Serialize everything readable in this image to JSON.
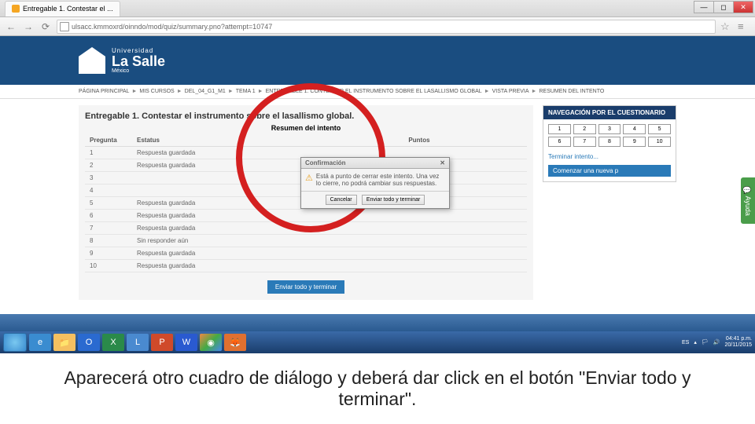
{
  "browser": {
    "tab_title": "Entregable 1. Contestar el ...",
    "url": "ulsacc.kmmoxrd/oinndo/mod/quiz/summary.pno?attempt=10747"
  },
  "logo": {
    "uni": "Universidad",
    "main": "La Salle",
    "sub": "México"
  },
  "breadcrumb": [
    "PÁGINA PRINCIPAL",
    "MIS CURSOS",
    "DEL_04_G1_M1",
    "TEMA 1",
    "ENTREGABLE 1. CONTESTAR EL INSTRUMENTO SOBRE EL LASALLISMO GLOBAL",
    "VISTA PREVIA",
    "RESUMEN DEL INTENTO"
  ],
  "page": {
    "title": "Entregable 1. Contestar el instrumento sobre el lasallismo global.",
    "table_title": "Resumen del intento",
    "headers": {
      "q": "Pregunta",
      "s": "Estatus",
      "p": "Puntos"
    },
    "rows": [
      {
        "n": "1",
        "s": "Respuesta guardada"
      },
      {
        "n": "2",
        "s": "Respuesta guardada"
      },
      {
        "n": "3",
        "s": ""
      },
      {
        "n": "4",
        "s": ""
      },
      {
        "n": "5",
        "s": "Respuesta guardada"
      },
      {
        "n": "6",
        "s": "Respuesta guardada"
      },
      {
        "n": "7",
        "s": "Respuesta guardada"
      },
      {
        "n": "8",
        "s": "Sin responder aún"
      },
      {
        "n": "9",
        "s": "Respuesta guardada"
      },
      {
        "n": "10",
        "s": "Respuesta guardada"
      }
    ],
    "submit": "Enviar todo y terminar"
  },
  "sidebar": {
    "title": "NAVEGACIÓN POR EL CUESTIONARIO",
    "nums": [
      "1",
      "2",
      "3",
      "4",
      "5",
      "6",
      "7",
      "8",
      "9",
      "10"
    ],
    "finish": "Terminar intento...",
    "new": "Comenzar una nueva p"
  },
  "dialog": {
    "title": "Confirmación",
    "body": "Está a punto de cerrar este intento. Una vez lo cierre, no podrá cambiar sus respuestas.",
    "cancel": "Cancelar",
    "confirm": "Enviar todo y terminar"
  },
  "ayuda": "Ayuda",
  "clock": {
    "time": "04:41 p.m.",
    "date": "20/11/2015"
  },
  "caption": "Aparecerá otro cuadro de diálogo y deberá dar click en el botón \"Enviar todo y terminar\"."
}
